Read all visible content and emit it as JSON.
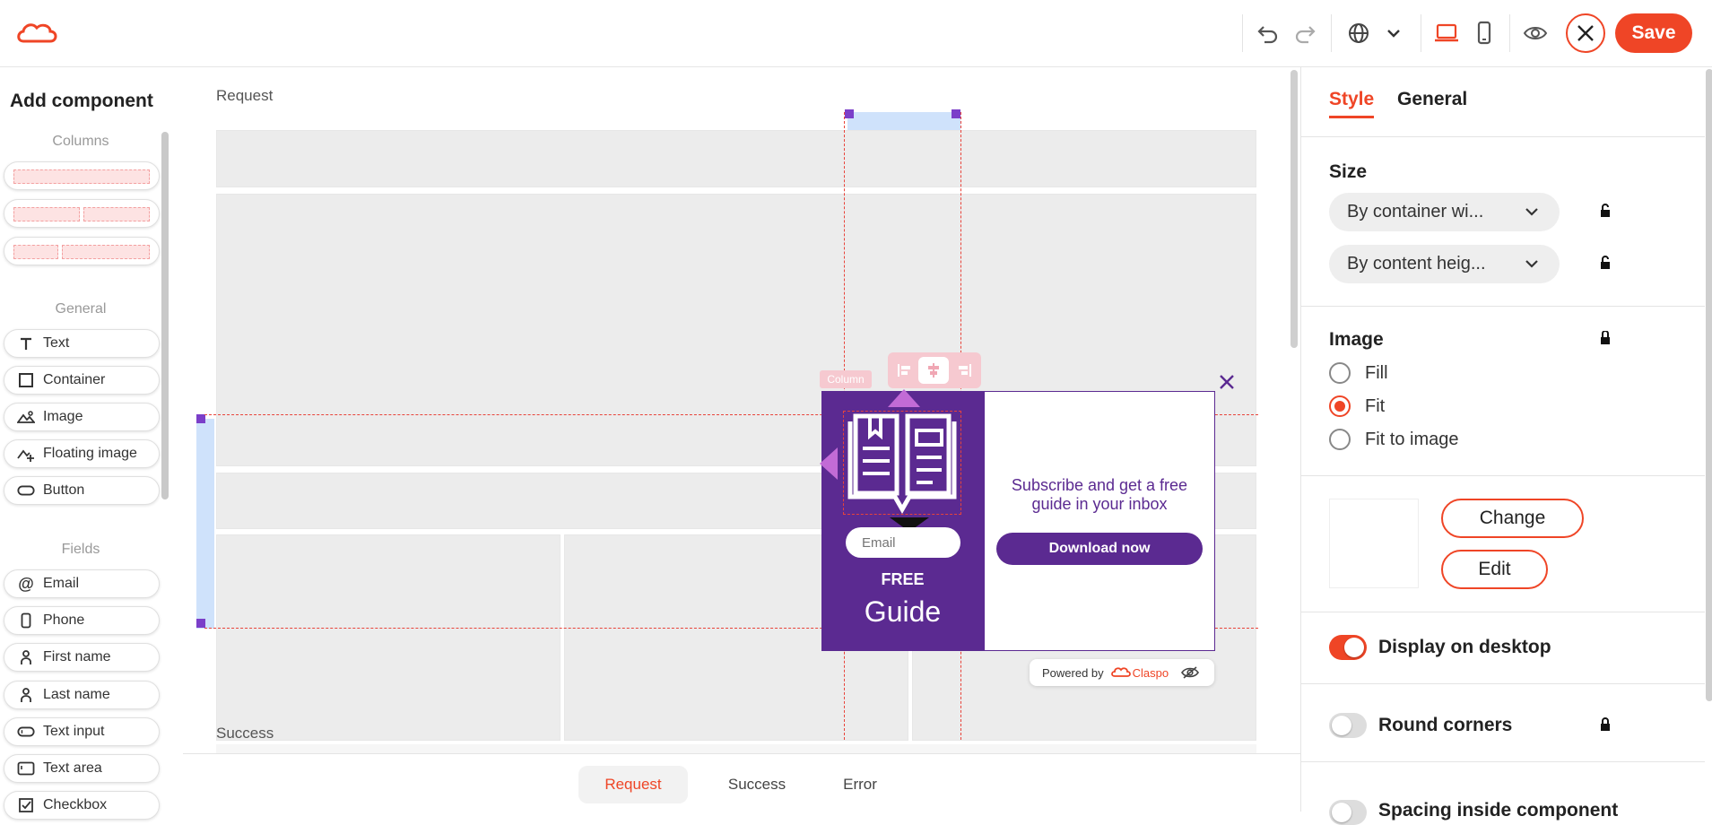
{
  "toolbar": {
    "save_label": "Save",
    "icons": [
      "logo-icon",
      "undo-icon",
      "redo-icon",
      "globe-icon",
      "chevron-down-icon",
      "desktop-icon",
      "mobile-icon",
      "eye-icon",
      "close-icon"
    ]
  },
  "left_panel": {
    "title": "Add component",
    "columns_label": "Columns",
    "general_label": "General",
    "general_items": [
      "Text",
      "Container",
      "Image",
      "Floating image",
      "Button"
    ],
    "fields_label": "Fields",
    "field_items": [
      "Email",
      "Phone",
      "First name",
      "Last name",
      "Text input",
      "Text area",
      "Checkbox"
    ]
  },
  "canvas": {
    "request_label": "Request",
    "success_label": "Success",
    "column_tag": "Column",
    "popup": {
      "email_placeholder": "Email",
      "free_label": "FREE",
      "guide_label": "Guide",
      "subscribe_text": "Subscribe and get a free guide in your inbox",
      "download_label": "Download now",
      "powered_by": "Powered by",
      "brand": "Claspo"
    }
  },
  "bottom_tabs": [
    {
      "label": "Request",
      "active": true
    },
    {
      "label": "Success",
      "active": false
    },
    {
      "label": "Error",
      "active": false
    }
  ],
  "right_panel": {
    "tabs": [
      {
        "label": "Style",
        "active": true
      },
      {
        "label": "General",
        "active": false
      }
    ],
    "size_title": "Size",
    "width_select": "By container wi...",
    "height_select": "By content heig...",
    "image_title": "Image",
    "image_options": [
      {
        "label": "Fill",
        "selected": false
      },
      {
        "label": "Fit",
        "selected": true
      },
      {
        "label": "Fit to image",
        "selected": false
      }
    ],
    "change_label": "Change",
    "edit_label": "Edit",
    "display_desktop": {
      "label": "Display on desktop",
      "on": true
    },
    "round_corners": {
      "label": "Round corners",
      "on": false
    },
    "spacing_inside": {
      "label": "Spacing inside component",
      "on": false
    }
  },
  "colors": {
    "accent": "#ef4526",
    "popup_purple": "#5b2a91",
    "selection": "#6a3cc8"
  }
}
